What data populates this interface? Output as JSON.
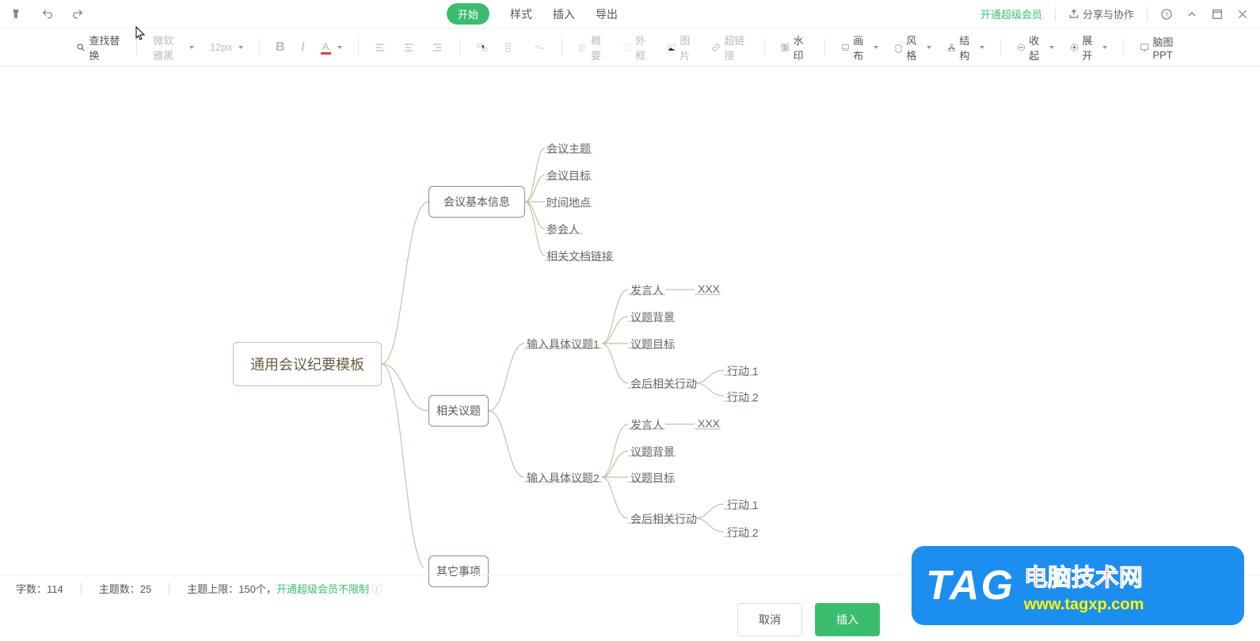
{
  "topbar": {
    "tabs": {
      "start": "开始",
      "style": "样式",
      "insert": "插入",
      "export": "导出"
    },
    "vip": "开通超级会员",
    "share": "分享与协作"
  },
  "toolbar": {
    "findReplace": "查找替换",
    "font": "微软雅黑",
    "size": "12px",
    "outline": "概要",
    "frame": "外框",
    "image": "图片",
    "link": "超链接",
    "watermark": "水印",
    "canvas": "画布",
    "theme": "风格",
    "structure": "结构",
    "collapse": "收起",
    "expand": "展开",
    "ppt": "脑图PPT"
  },
  "mindmap": {
    "root": "通用会议纪要模板",
    "b1": "会议基本信息",
    "b1_leaves": [
      "会议主题",
      "会议目标",
      "时间地点",
      "参会人",
      "相关文档链接"
    ],
    "b2": "相关议题",
    "b2_topic1": "输入具体议题1",
    "b2_topic2": "输入具体议题2",
    "t_leaves": [
      "发言人",
      "议题背景",
      "议题目标",
      "会后相关行动"
    ],
    "xxx": "XXX",
    "action1": "行动 1",
    "action2": "行动 2",
    "b3": "其它事项"
  },
  "status": {
    "words_label": "字数：",
    "words_value": "114",
    "topics_label": "主题数：",
    "topics_value": "25",
    "limit_label": "主题上限：",
    "limit_value": "150个，",
    "vip_unlimited": "开通超级会员不限制"
  },
  "buttons": {
    "cancel": "取消",
    "insert": "插入"
  },
  "watermark_tag": {
    "big": "TAG",
    "cn": "电脑技术网",
    "url": "www.tagxp.com"
  }
}
